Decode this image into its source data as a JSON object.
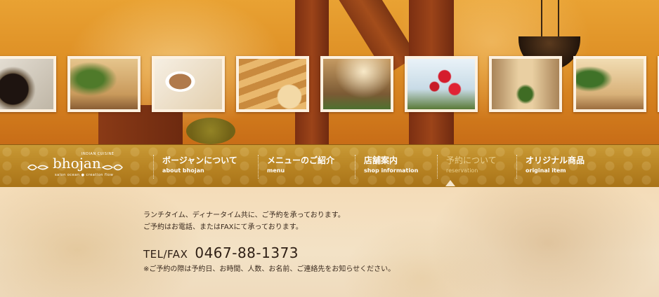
{
  "brand": {
    "name": "bhojan",
    "tagline_top": "INDIAN CUISINE",
    "tagline_bottom": "salon ocean ● creation flow"
  },
  "gallery": {
    "photos": [
      {
        "subject": "spices in bowl"
      },
      {
        "subject": "dining room with plant"
      },
      {
        "subject": "chai and cookies"
      },
      {
        "subject": "baked sweets"
      },
      {
        "subject": "dining hall"
      },
      {
        "subject": "red flowers"
      },
      {
        "subject": "entrance with plant"
      },
      {
        "subject": "dining room tables"
      }
    ]
  },
  "nav": {
    "items": [
      {
        "jp": "ボージャンについて",
        "en": "about bhojan",
        "active": false
      },
      {
        "jp": "メニューのご紹介",
        "en": "menu",
        "active": false
      },
      {
        "jp": "店舗案内",
        "en": "shop information",
        "active": false
      },
      {
        "jp": "予約について",
        "en": "reservation",
        "active": true
      },
      {
        "jp": "オリジナル商品",
        "en": "original item",
        "active": false
      }
    ]
  },
  "content": {
    "line1": "ランチタイム、ディナータイム共に、ご予約を承っております。",
    "line2": "ご予約はお電話、またはFAXにて承っております。",
    "tel_label": "TEL/FAX",
    "tel_number": "0467-88-1373",
    "note": "※ご予約の際は予約日、お時間、人数、お名前、ご連絡先をお知らせください。"
  },
  "colors": {
    "nav_gold": "#b98524",
    "text_dark": "#3a2a1e",
    "active_text": "#e9cf8e"
  }
}
